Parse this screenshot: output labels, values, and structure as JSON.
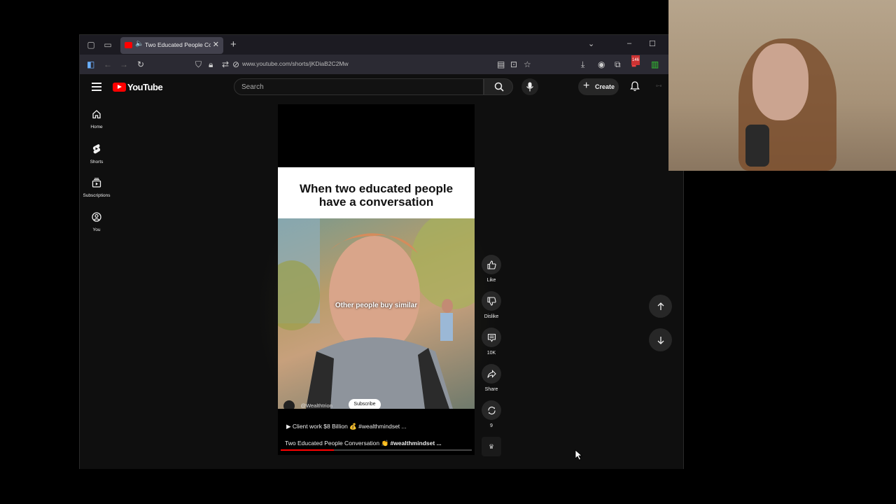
{
  "browser": {
    "tab_title": "Two Educated People Conv",
    "url": "www.youtube.com/shorts/jKDiaB2C2Mw",
    "extensions_badge": "146"
  },
  "youtube": {
    "logo_text": "YouTube",
    "search_placeholder": "Search",
    "create_label": "Create",
    "sidebar": [
      {
        "label": "Home",
        "icon": "home-icon"
      },
      {
        "label": "Shorts",
        "icon": "shorts-icon"
      },
      {
        "label": "Subscriptions",
        "icon": "subscriptions-icon"
      },
      {
        "label": "You",
        "icon": "you-icon"
      }
    ],
    "short": {
      "caption_line1": "When two educated people",
      "caption_line2": "have a conversation",
      "subtitle": "Other people buy similar",
      "channel": "@Wealthtrion",
      "subscribe_label": "Subscribe",
      "music_line": "Client work $8 Billion 💰 #wealthmindset ...",
      "title_prefix": "Two Educated People Conversation 👏 ",
      "title_tag": "#wealthmindset ...",
      "progress": 0.28
    },
    "actions": {
      "like": "Like",
      "dislike": "Dislike",
      "comments": "10K",
      "share": "Share",
      "remix": "9"
    }
  },
  "colors": {
    "accent_red": "#ff0000",
    "background": "#0f0f0f",
    "chip": "#272727"
  }
}
